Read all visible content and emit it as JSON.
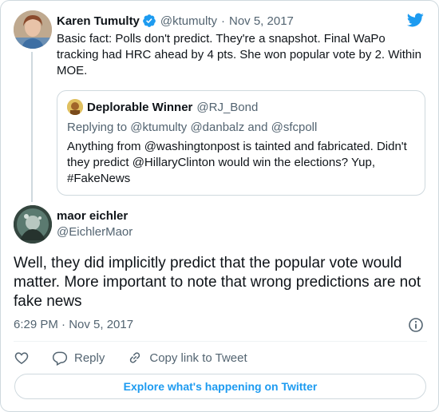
{
  "parent_tweet": {
    "author_name": "Karen Tumulty",
    "handle": "@ktumulty",
    "separator": "·",
    "date": "Nov 5, 2017",
    "text": "Basic fact: Polls don't predict. They're a snapshot. Final WaPo tracking had HRC ahead by 4 pts. She won popular vote by 2. Within MOE."
  },
  "quoted_tweet": {
    "author_name": "Deplorable Winner",
    "handle": "@RJ_Bond",
    "replying_to": "Replying to @ktumulty @danbalz and @sfcpoll",
    "text": "Anything from @washingtonpost is tainted and fabricated. Didn't they predict @HillaryClinton would win the elections? Yup, #FakeNews"
  },
  "main_tweet": {
    "author_name": "maor eichler",
    "handle": "@EichlerMaor",
    "text": "Well, they did implicitly predict that the popular vote would matter. More important to note that wrong predictions are not fake news",
    "timestamp": "6:29 PM · Nov 5, 2017"
  },
  "actions": {
    "reply_label": "Reply",
    "copy_link_label": "Copy link to Tweet"
  },
  "footer": {
    "explore_label": "Explore what's happening on Twitter"
  },
  "colors": {
    "brand_blue": "#1d9bf0",
    "text_primary": "#0f1419",
    "text_secondary": "#536471",
    "border": "#cfd9de"
  }
}
